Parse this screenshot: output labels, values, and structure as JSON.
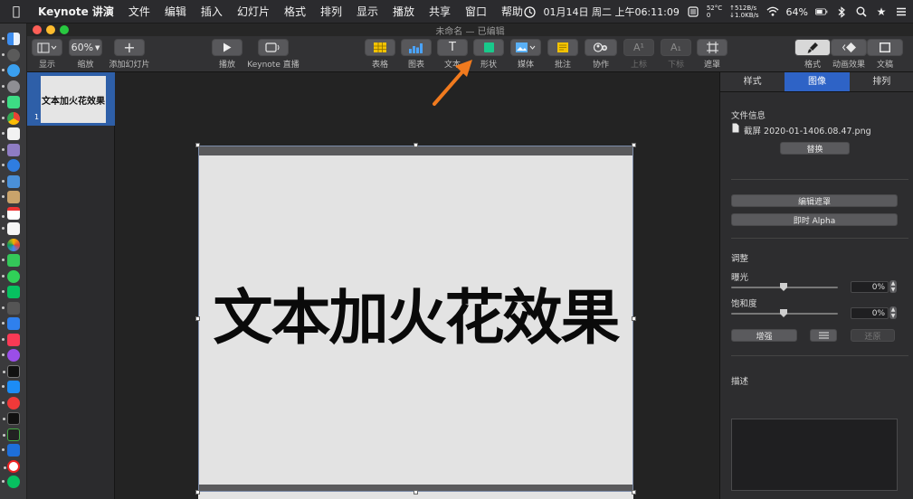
{
  "menubar": {
    "app_name": "Keynote 讲演",
    "items": [
      "文件",
      "编辑",
      "插入",
      "幻灯片",
      "格式",
      "排列",
      "显示",
      "播放",
      "共享",
      "窗口",
      "帮助"
    ],
    "datetime": "01月14日 周二 上午06:11:09",
    "temperature": "52°C",
    "fan": "0",
    "net_up": "↑512B/s",
    "net_down": "↓1.0KB/s",
    "battery": "64%",
    "icons": [
      "apple-icon",
      "clock-icon",
      "bluetooth-icon",
      "wifi-icon",
      "battery-icon",
      "search-icon",
      "star-icon",
      "menu-icon"
    ]
  },
  "window": {
    "title": "未命名 — 已编辑"
  },
  "toolbar": {
    "view_label": "显示",
    "zoom_value": "60%",
    "zoom_label": "缩放",
    "add_slide_label": "添加幻灯片",
    "play_label": "播放",
    "live_label": "Keynote 直播",
    "table_label": "表格",
    "chart_label": "图表",
    "text_label": "文本",
    "text_glyph": "T",
    "shape_label": "形状",
    "media_label": "媒体",
    "comment_label": "批注",
    "collab_label": "协作",
    "superscript_label": "上标",
    "superscript_glyph": "A¹",
    "subscript_label": "下标",
    "subscript_glyph": "A₁",
    "mask_label": "遮罩",
    "format_label": "格式",
    "animate_label": "动画效果",
    "document_label": "文稿"
  },
  "navigator": {
    "slides": [
      {
        "number": "1",
        "thumb_text": "文本加火花效果"
      }
    ]
  },
  "slide": {
    "text": "文本加火花效果"
  },
  "inspector": {
    "tabs": [
      "样式",
      "图像",
      "排列"
    ],
    "active_tab": "图像",
    "file_info_label": "文件信息",
    "file_name": "截屏 2020-01-1406.08.47.png",
    "replace_button": "替换",
    "edit_mask_button": "编辑遮罩",
    "instant_alpha_button": "即时 Alpha",
    "adjust_label": "调整",
    "exposure_label": "曝光",
    "exposure_value": "0%",
    "saturation_label": "饱和度",
    "saturation_value": "0%",
    "enhance_button": "增强",
    "reset_button": "还原",
    "description_label": "描述"
  },
  "colors": {
    "accent": "#2e63c6",
    "annotation_arrow": "#f07a1e",
    "slide_bg": "#e3e3e3",
    "canvas_bg": "#232323"
  }
}
